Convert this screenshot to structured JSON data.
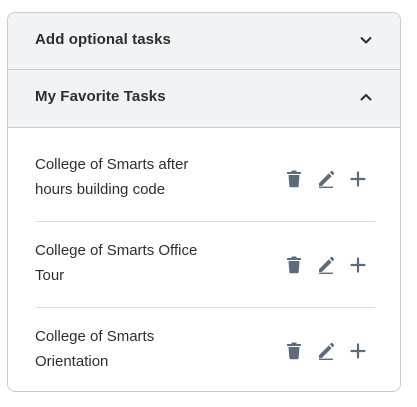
{
  "optional_section": {
    "title": "Add optional tasks",
    "expanded": false,
    "chevron_icon": "chevron-down-icon"
  },
  "favorites_section": {
    "title": "My Favorite Tasks",
    "expanded": true,
    "chevron_icon": "chevron-up-icon",
    "tasks": [
      {
        "name": "College of Smarts after hours building code",
        "actions": [
          "trash-icon",
          "pencil-icon",
          "plus-icon"
        ]
      },
      {
        "name": "College of Smarts Office Tour",
        "actions": [
          "trash-icon",
          "pencil-icon",
          "plus-icon"
        ]
      },
      {
        "name": "College of Smarts Orientation",
        "actions": [
          "trash-icon",
          "pencil-icon",
          "plus-icon"
        ]
      }
    ]
  },
  "colors": {
    "header_bg": "#f1f3f5",
    "border": "#c7ccd1",
    "text": "#2b2f33",
    "icon": "#5b6b7b"
  }
}
